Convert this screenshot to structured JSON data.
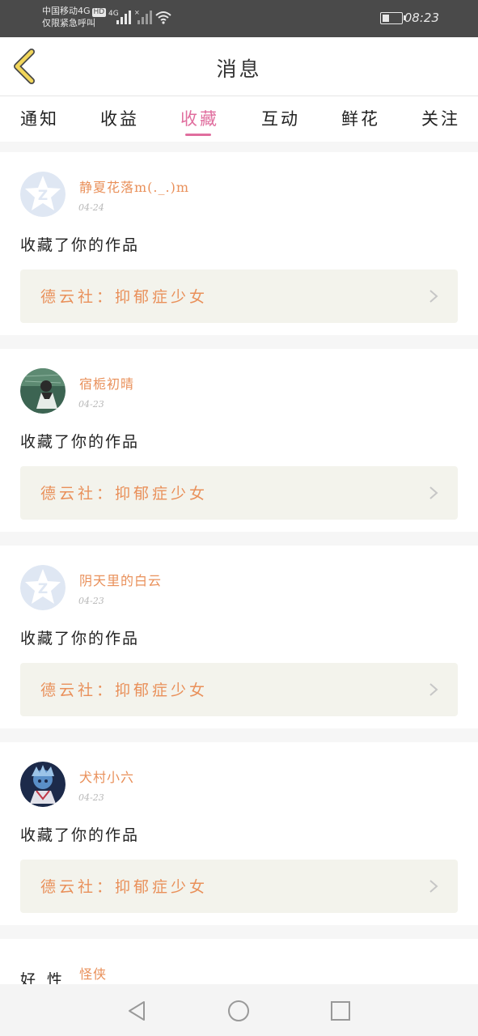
{
  "status_bar": {
    "carrier_line1": "中国移动4G",
    "hd_badge": "HD",
    "carrier_line2": "仅限紧急呼叫",
    "network": "4G",
    "time": "08:23"
  },
  "header": {
    "title": "消息"
  },
  "tabs": [
    {
      "label": "通知",
      "active": false
    },
    {
      "label": "收益",
      "active": false
    },
    {
      "label": "收藏",
      "active": true
    },
    {
      "label": "互动",
      "active": false
    },
    {
      "label": "鲜花",
      "active": false
    },
    {
      "label": "关注",
      "active": false
    }
  ],
  "messages": [
    {
      "username": "静夏花落m(._.)m",
      "date": "04-24",
      "action": "收藏了你的作品",
      "work": "德云社：抑郁症少女",
      "avatar": "default-qq-avatar"
    },
    {
      "username": "宿栀初晴",
      "date": "04-23",
      "action": "收藏了你的作品",
      "work": "德云社：抑郁症少女",
      "avatar": "photo-avatar"
    },
    {
      "username": "阴天里的白云",
      "date": "04-23",
      "action": "收藏了你的作品",
      "work": "德云社：抑郁症少女",
      "avatar": "default-qq-avatar"
    },
    {
      "username": "犬村小六",
      "date": "04-23",
      "action": "收藏了你的作品",
      "work": "德云社：抑郁症少女",
      "avatar": "anime-avatar"
    },
    {
      "username": "怪侠",
      "avatar_text": "好 性",
      "avatar": "text-avatar"
    }
  ],
  "colors": {
    "accent_pink": "#e06e9e",
    "name_orange": "#e9905a",
    "work_bg": "#f3f3ec",
    "back_yellow": "#f2d65a"
  }
}
